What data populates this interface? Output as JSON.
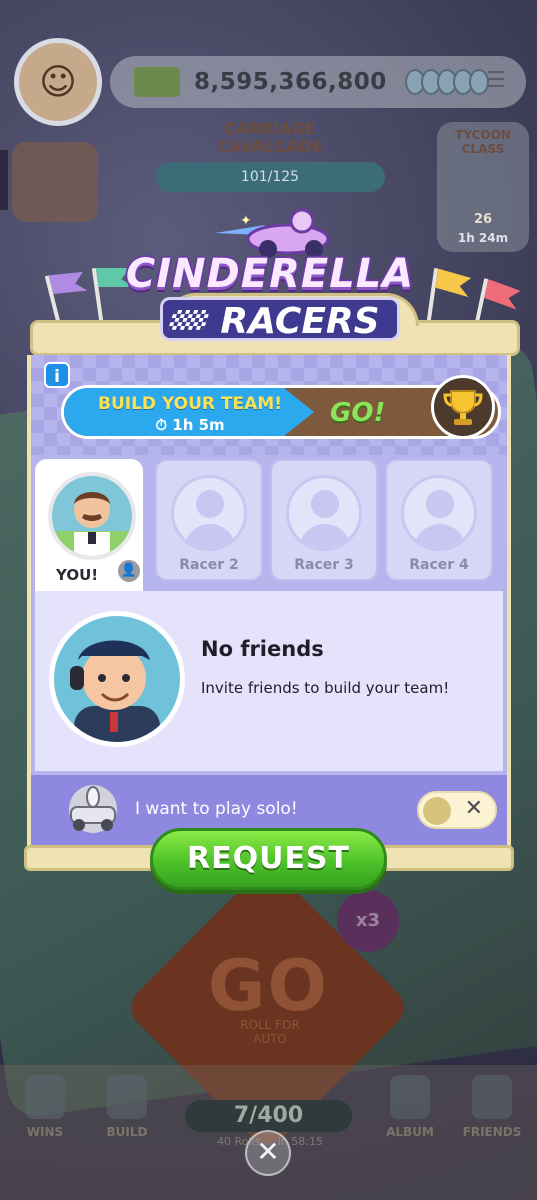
{
  "background": {
    "cash": "8,595,366,800",
    "event_title_line1": "CARRIAGE",
    "event_title_line2": "CAVALCADE",
    "event_progress": "101/125",
    "tycoon_line1": "TYCOON",
    "tycoon_line2": "CLASS",
    "tycoon_level": "26",
    "tycoon_timer": "1h 24m",
    "go_label": "GO",
    "roll_label": "ROLL FOR AUTO",
    "x3_label": "x3",
    "dice_count": "7/400",
    "dice_regen": "40 Rolls ... in 58:15",
    "nav": [
      "WINS",
      "BUILD",
      "ALBUM",
      "FRIENDS"
    ]
  },
  "modal": {
    "logo_line1": "CINDERELLA",
    "logo_line2": "RACERS",
    "info_icon": "i",
    "team_bar": {
      "title": "BUILD YOUR TEAM!",
      "timer": "1h 5m",
      "go": "GO!"
    },
    "racers": [
      {
        "label": "YOU!"
      },
      {
        "label": "Racer 2"
      },
      {
        "label": "Racer 3"
      },
      {
        "label": "Racer 4"
      }
    ],
    "friends": {
      "title": "No friends",
      "text": "Invite friends to build your team!"
    },
    "solo": {
      "text": "I want to play solo!",
      "toggle_icon": "✕"
    },
    "request_label": "REQUEST",
    "close_icon": "✕"
  },
  "colors": {
    "panel": "#b6b4ec",
    "request_green": "#4cc22a",
    "team_blue": "#2ca9ee"
  }
}
